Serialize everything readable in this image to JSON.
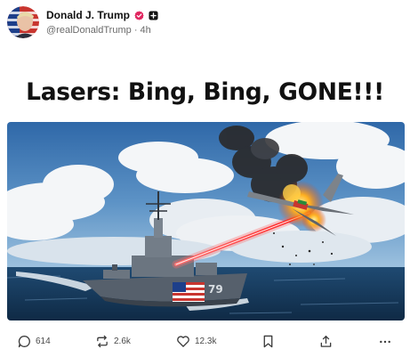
{
  "post": {
    "author_name": "Donald J. Trump",
    "handle": "@realDonaldTrump",
    "separator": "·",
    "time": "4h",
    "headline": "Lasers: Bing, Bing, GONE!!!",
    "ship_hull_number": "79"
  },
  "actions": {
    "reply_count": "614",
    "repost_count": "2.6k",
    "like_count": "12.3k"
  },
  "colors": {
    "verified_badge": "#e0245e",
    "laser": "#ff2a2a",
    "text_secondary": "#6b6b6b"
  },
  "icons": [
    "avatar",
    "verified-badge-icon",
    "plus-badge-icon",
    "reply-icon",
    "repost-icon",
    "like-icon",
    "bookmark-icon",
    "share-icon",
    "more-icon"
  ]
}
